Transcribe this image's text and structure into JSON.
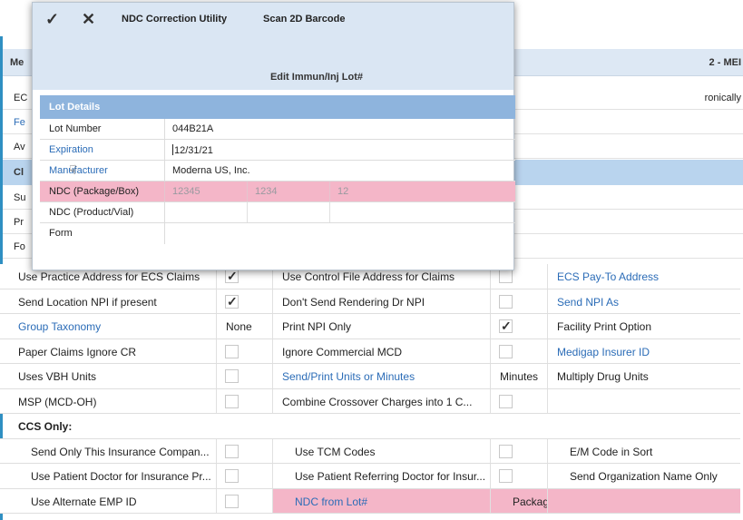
{
  "toolbar": {
    "ok_icon": "check-icon",
    "cancel_icon": "close-icon",
    "ndc_correction": "NDC Correction Utility",
    "scan_barcode": "Scan 2D Barcode"
  },
  "dialog": {
    "title": "Edit Immun/Inj Lot#",
    "section": "Lot Details",
    "fields": [
      {
        "label": "Lot Number",
        "value": "044B21A",
        "link": false
      },
      {
        "label": "Expiration",
        "value": "12/31/21",
        "link": true
      },
      {
        "label": "Manufacturer",
        "value": "Moderna US, Inc.",
        "link": true
      },
      {
        "label": "NDC (Package/Box)",
        "segments": [
          "12345",
          "1234",
          "12"
        ],
        "link": false
      },
      {
        "label": "NDC (Product/Vial)",
        "value": "",
        "link": false
      },
      {
        "label": "Form",
        "value": "",
        "link": false
      }
    ]
  },
  "background": {
    "title_left": "Me",
    "title_right": "2 - MEI",
    "row_ec": "EC",
    "row_ec_right": "ronically",
    "row_fe": "Fe",
    "row_av": "Av",
    "band": "Cl",
    "su": "Su",
    "pr": "Pr",
    "fo": "Fo"
  },
  "grid": {
    "rows": [
      {
        "c1": "Use Practice Address for ECS Claims",
        "c2": "check-on",
        "c3": "Use Control File Address for Claims",
        "c4": "check-off",
        "c5": "ECS Pay-To Address",
        "c5_link": true
      },
      {
        "c1": "Send Location NPI if present",
        "c2": "check-on",
        "c3": "Don't Send Rendering Dr NPI",
        "c4": "check-off",
        "c5": "Send NPI As",
        "c5_link": true
      },
      {
        "c1": "Group Taxonomy",
        "c1_link": true,
        "c2": "None",
        "c3": "Print NPI Only",
        "c4": "check-on",
        "c5": "Facility Print Option"
      },
      {
        "c1": "Paper Claims Ignore CR",
        "c2": "check-off",
        "c3": "Ignore Commercial MCD",
        "c4": "check-off",
        "c5": "Medigap Insurer ID",
        "c5_link": true
      },
      {
        "c1": "Uses VBH Units",
        "c2": "check-off",
        "c3": "Send/Print Units or Minutes",
        "c3_link": true,
        "c4": "Minutes",
        "c5": "Multiply Drug Units"
      },
      {
        "c1": "MSP (MCD-OH)",
        "c2": "check-off",
        "c3": "Combine Crossover Charges into 1 C...",
        "c4": "check-off",
        "c5": ""
      }
    ],
    "ccs_header": "CCS Only:",
    "ccs_rows": [
      {
        "c1": "Send Only This Insurance Compan...",
        "c2": "check-off",
        "c3": "Use TCM Codes",
        "c4": "check-off",
        "c5": "E/M Code in Sort"
      },
      {
        "c1": "Use Patient Doctor for Insurance Pr...",
        "c2": "check-off",
        "c3": "Use Patient Referring Doctor for Insur...",
        "c4": "check-off",
        "c5": "Send Organization Name Only"
      },
      {
        "c1": "Use Alternate EMP ID",
        "c2": "check-off",
        "c3": "NDC from Lot#",
        "c3_link": true,
        "c4": "Package",
        "c5": "",
        "pink": true
      }
    ]
  }
}
